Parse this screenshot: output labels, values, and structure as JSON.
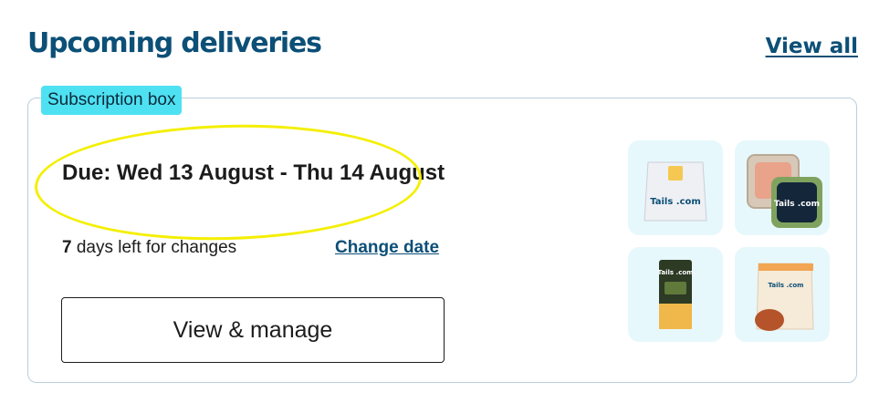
{
  "header": {
    "title": "Upcoming deliveries",
    "view_all_label": "View all"
  },
  "delivery": {
    "badge": "Subscription box",
    "due_text": "Due: Wed 13 August - Thu 14 August",
    "days_left_number": "7",
    "days_left_text": " days left for changes",
    "change_date_label": "Change date",
    "manage_button_label": "View & manage"
  },
  "products": [
    {
      "name": "dry-food-bag",
      "logo": "Tails .com"
    },
    {
      "name": "wet-food-trays",
      "logo": "Tails .com"
    },
    {
      "name": "poo-bags",
      "logo": "Tails .com"
    },
    {
      "name": "pig-ears-treats",
      "logo": "Tails .com"
    }
  ],
  "colors": {
    "brand": "#0c4f77",
    "badge": "#4ee1f2",
    "highlight": "#f4ef00",
    "tile": "#e7f8fc"
  }
}
